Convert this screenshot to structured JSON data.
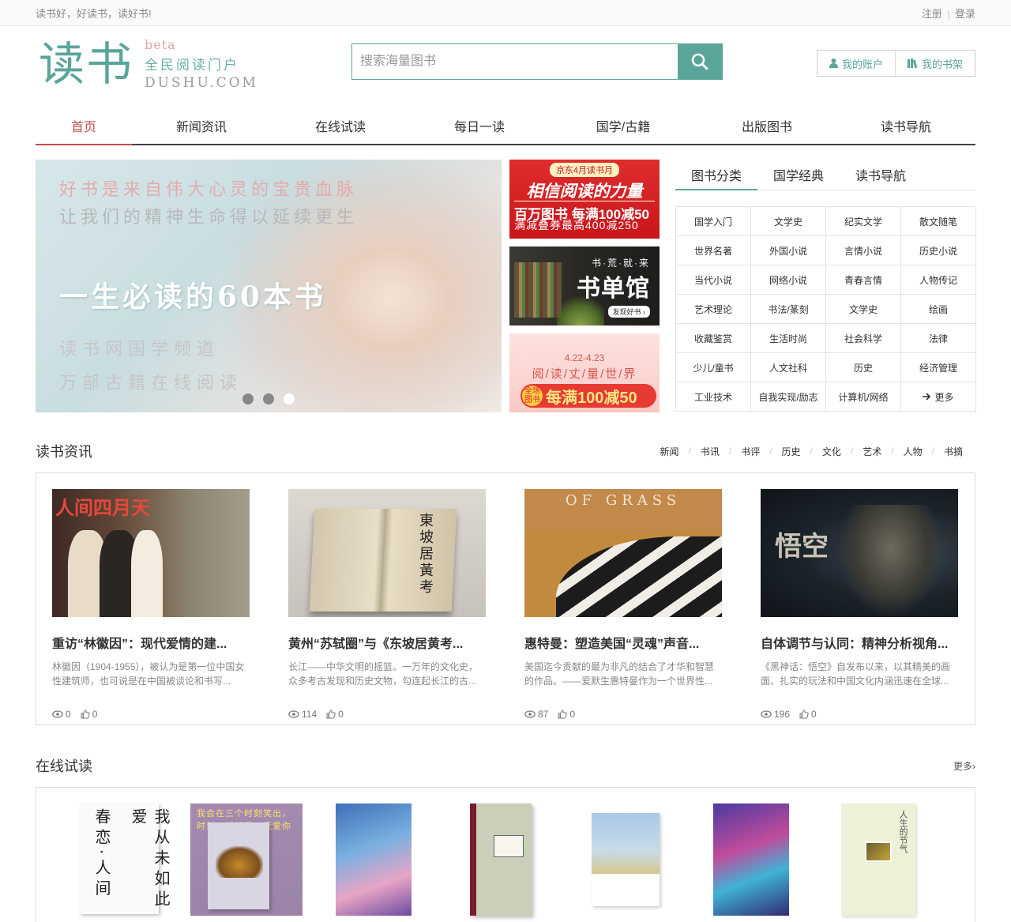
{
  "topbar": {
    "slogan": "读书好，好读书，读好书!",
    "register": "注册",
    "sep": "|",
    "login": "登录"
  },
  "logo": {
    "main": "读书",
    "beta": "beta",
    "slogan": "全民阅读门户",
    "domain": "DUSHU.COM"
  },
  "search": {
    "placeholder": "搜索海量图书",
    "icon": "search-icon"
  },
  "account": {
    "my_account": "我的账户",
    "my_shelf": "我的书架"
  },
  "nav": [
    "首页",
    "新闻资讯",
    "在线试读",
    "每日一读",
    "国学/古籍",
    "出版图书",
    "读书导航"
  ],
  "nav_active": 0,
  "banner": {
    "line1": "好书是来自伟大心灵的宝贵血脉",
    "line2": "让我们的精神生命得以延续更生",
    "title": "一生必读的60本书",
    "line3": "读书网国学频道",
    "line4": "万部古籍在线阅读",
    "dots": 3,
    "active_dot": 2
  },
  "ads": {
    "ad1": {
      "tag": "京东4月读书月",
      "title": "相信阅读的力量",
      "line1": "百万图书 每满100减50",
      "line2": "满减叠券最高400减250"
    },
    "ad2": {
      "small": "书·荒·就·来",
      "title": "书单馆",
      "tag": "发现好书 ›"
    },
    "ad3": {
      "date": "4.22-4.23",
      "title": "阅/读/丈/量/世/界",
      "badge": "全场图书",
      "promo": "每满100减50"
    }
  },
  "categories": {
    "tabs": [
      "图书分类",
      "国学经典",
      "读书导航"
    ],
    "active_tab": 0,
    "items": [
      "国学入门",
      "文学史",
      "纪实文学",
      "散文随笔",
      "世界名著",
      "外国小说",
      "言情小说",
      "历史小说",
      "当代小说",
      "网络小说",
      "青春言情",
      "人物传记",
      "艺术理论",
      "书法/篆刻",
      "文学史",
      "绘画",
      "收藏鉴赏",
      "生活时尚",
      "社会科学",
      "法律",
      "少儿/童书",
      "人文社科",
      "历史",
      "经济管理",
      "工业技术",
      "自我实现/励志",
      "计算机/网络",
      "更多"
    ]
  },
  "news_section": {
    "title": "读书资讯",
    "links": [
      "新闻",
      "书讯",
      "书评",
      "历史",
      "文化",
      "艺术",
      "人物",
      "书摘"
    ],
    "items": [
      {
        "title": "重访“林徽因”：现代爱情的建...",
        "desc": "林徽因（1904-1955），被认为是第一位中国女性建筑师，也可说是在中国被谈论和书写...",
        "views": "0",
        "likes": "0",
        "img_text": "人间四月天"
      },
      {
        "title": "黄州“苏轼圈”与《东坡居黄考...",
        "desc": "长江——中华文明的摇篮。一万年的文化史，众多考古发现和历史文物，勾连起长江的古...",
        "views": "114",
        "likes": "0",
        "img_text": "東坡居黃考"
      },
      {
        "title": "惠特曼：塑造美国“灵魂”声音...",
        "desc": "美国迄今贡献的最为非凡的结合了才华和智慧的作品。——爱默生惠特曼作为一个世界性...",
        "views": "87",
        "likes": "0",
        "img_text": "OF GRASS"
      },
      {
        "title": "自体调节与认同：精神分析视角...",
        "desc": "《黑神话：悟空》自发布以来，以其精美的画面、扎实的玩法和中国文化内涵迅速在全球...",
        "views": "196",
        "likes": "0",
        "img_text": "悟空"
      }
    ]
  },
  "trial_section": {
    "title": "在线试读",
    "more": "更多›",
    "books": [
      {
        "cover_text": "春恋·人间",
        "cover_text2": "我从未如此爱"
      },
      {
        "cover_text": "我会在三个时刻笑出，时刻，好好爱，我爱你"
      },
      {
        "cover_text": ""
      },
      {
        "cover_text": ""
      },
      {
        "cover_text": ""
      },
      {
        "cover_text": ""
      },
      {
        "cover_text": "人生的节气"
      }
    ]
  },
  "colors": {
    "accent": "#5aa59a",
    "active_nav": "#c0504d"
  }
}
